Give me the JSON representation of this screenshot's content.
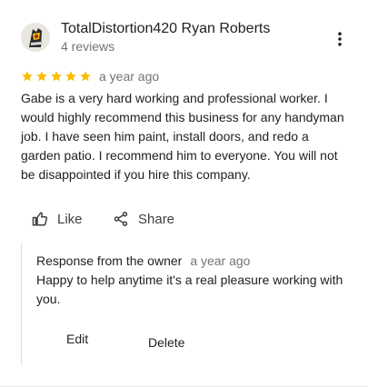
{
  "review": {
    "reviewer_name": "TotalDistortion420 Ryan Roberts",
    "reviewer_meta": "4 reviews",
    "rating": 5,
    "rating_max": 5,
    "time": "a year ago",
    "text": "Gabe is a very hard working and professional worker. I would highly recommend this business for any handyman job. I have seen him paint, install doors, and redo a garden patio. I recommend him to everyone. You will not be disappointed if you hire this company."
  },
  "actions": {
    "like_label": "Like",
    "share_label": "Share"
  },
  "owner_response": {
    "title": "Response from the owner",
    "time": "a year ago",
    "text": "Happy to help anytime it's a real pleasure working with you.",
    "edit_label": "Edit",
    "delete_label": "Delete"
  },
  "icons": {
    "more": "more-vert-icon",
    "star": "star-icon",
    "like": "thumb-up-icon",
    "share": "share-icon"
  },
  "colors": {
    "star": "#fbbc04",
    "text_primary": "#202124",
    "text_secondary": "#70757a",
    "divider": "#dadce0"
  }
}
